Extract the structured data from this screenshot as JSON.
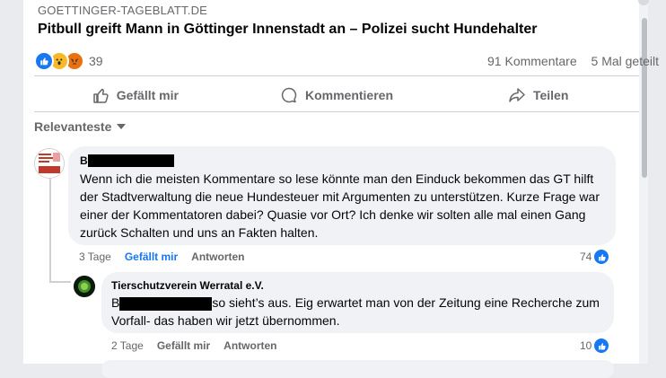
{
  "post": {
    "source": "GOETTINGER-TAGEBLATT.DE",
    "headline": "Pitbull greift Mann in Göttinger Innenstadt an – Polizei sucht Hundehalter",
    "reaction_count": "39",
    "comments_count": "91 Kommentare",
    "shares_count": "5 Mal geteilt"
  },
  "actions": {
    "like": "Gefällt mir",
    "comment": "Kommentieren",
    "share": "Teilen"
  },
  "sort": {
    "label": "Relevanteste"
  },
  "comments": [
    {
      "author": "B",
      "text": "Wenn ich die meisten Kommentare so lese könnte man den Einduck bekommen das GT hilft der Stadtverwaltung die neue Hundesteuer mit Argumenten zu unterstützen. Kurze Frage war einer der Kommentatoren dabei? Quasie vor Ort? Ich denke wir solten alle mal einen Gang zurück Schalten und uns an Fakten halten.",
      "time": "3 Tage",
      "like_label": "Gefällt mir",
      "reply_label": "Antworten",
      "likes": "74"
    },
    {
      "author": "Tierschutzverein Werratal e.V.",
      "text_prefix": "B",
      "text": "so sieht’s aus. Eig erwartet man von der Zeitung eine Recherche zum Vorfall- das haben wir jetzt übernommen.",
      "time": "2 Tage",
      "like_label": "Gefällt mir",
      "reply_label": "Antworten",
      "likes": "10"
    }
  ],
  "colors": {
    "accent": "#1877f2",
    "muted": "#65676b",
    "bubble": "#f0f2f5"
  }
}
